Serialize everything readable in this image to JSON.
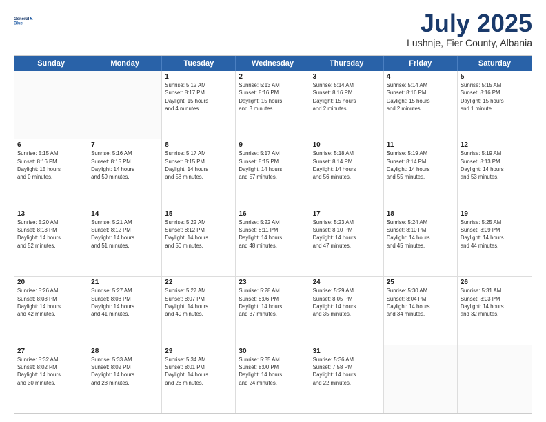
{
  "logo": {
    "line1": "General",
    "line2": "Blue"
  },
  "title": "July 2025",
  "subtitle": "Lushnje, Fier County, Albania",
  "header_days": [
    "Sunday",
    "Monday",
    "Tuesday",
    "Wednesday",
    "Thursday",
    "Friday",
    "Saturday"
  ],
  "weeks": [
    [
      {
        "day": "",
        "info": ""
      },
      {
        "day": "",
        "info": ""
      },
      {
        "day": "1",
        "info": "Sunrise: 5:12 AM\nSunset: 8:17 PM\nDaylight: 15 hours\nand 4 minutes."
      },
      {
        "day": "2",
        "info": "Sunrise: 5:13 AM\nSunset: 8:16 PM\nDaylight: 15 hours\nand 3 minutes."
      },
      {
        "day": "3",
        "info": "Sunrise: 5:14 AM\nSunset: 8:16 PM\nDaylight: 15 hours\nand 2 minutes."
      },
      {
        "day": "4",
        "info": "Sunrise: 5:14 AM\nSunset: 8:16 PM\nDaylight: 15 hours\nand 2 minutes."
      },
      {
        "day": "5",
        "info": "Sunrise: 5:15 AM\nSunset: 8:16 PM\nDaylight: 15 hours\nand 1 minute."
      }
    ],
    [
      {
        "day": "6",
        "info": "Sunrise: 5:15 AM\nSunset: 8:16 PM\nDaylight: 15 hours\nand 0 minutes."
      },
      {
        "day": "7",
        "info": "Sunrise: 5:16 AM\nSunset: 8:15 PM\nDaylight: 14 hours\nand 59 minutes."
      },
      {
        "day": "8",
        "info": "Sunrise: 5:17 AM\nSunset: 8:15 PM\nDaylight: 14 hours\nand 58 minutes."
      },
      {
        "day": "9",
        "info": "Sunrise: 5:17 AM\nSunset: 8:15 PM\nDaylight: 14 hours\nand 57 minutes."
      },
      {
        "day": "10",
        "info": "Sunrise: 5:18 AM\nSunset: 8:14 PM\nDaylight: 14 hours\nand 56 minutes."
      },
      {
        "day": "11",
        "info": "Sunrise: 5:19 AM\nSunset: 8:14 PM\nDaylight: 14 hours\nand 55 minutes."
      },
      {
        "day": "12",
        "info": "Sunrise: 5:19 AM\nSunset: 8:13 PM\nDaylight: 14 hours\nand 53 minutes."
      }
    ],
    [
      {
        "day": "13",
        "info": "Sunrise: 5:20 AM\nSunset: 8:13 PM\nDaylight: 14 hours\nand 52 minutes."
      },
      {
        "day": "14",
        "info": "Sunrise: 5:21 AM\nSunset: 8:12 PM\nDaylight: 14 hours\nand 51 minutes."
      },
      {
        "day": "15",
        "info": "Sunrise: 5:22 AM\nSunset: 8:12 PM\nDaylight: 14 hours\nand 50 minutes."
      },
      {
        "day": "16",
        "info": "Sunrise: 5:22 AM\nSunset: 8:11 PM\nDaylight: 14 hours\nand 48 minutes."
      },
      {
        "day": "17",
        "info": "Sunrise: 5:23 AM\nSunset: 8:10 PM\nDaylight: 14 hours\nand 47 minutes."
      },
      {
        "day": "18",
        "info": "Sunrise: 5:24 AM\nSunset: 8:10 PM\nDaylight: 14 hours\nand 45 minutes."
      },
      {
        "day": "19",
        "info": "Sunrise: 5:25 AM\nSunset: 8:09 PM\nDaylight: 14 hours\nand 44 minutes."
      }
    ],
    [
      {
        "day": "20",
        "info": "Sunrise: 5:26 AM\nSunset: 8:08 PM\nDaylight: 14 hours\nand 42 minutes."
      },
      {
        "day": "21",
        "info": "Sunrise: 5:27 AM\nSunset: 8:08 PM\nDaylight: 14 hours\nand 41 minutes."
      },
      {
        "day": "22",
        "info": "Sunrise: 5:27 AM\nSunset: 8:07 PM\nDaylight: 14 hours\nand 40 minutes."
      },
      {
        "day": "23",
        "info": "Sunrise: 5:28 AM\nSunset: 8:06 PM\nDaylight: 14 hours\nand 37 minutes."
      },
      {
        "day": "24",
        "info": "Sunrise: 5:29 AM\nSunset: 8:05 PM\nDaylight: 14 hours\nand 35 minutes."
      },
      {
        "day": "25",
        "info": "Sunrise: 5:30 AM\nSunset: 8:04 PM\nDaylight: 14 hours\nand 34 minutes."
      },
      {
        "day": "26",
        "info": "Sunrise: 5:31 AM\nSunset: 8:03 PM\nDaylight: 14 hours\nand 32 minutes."
      }
    ],
    [
      {
        "day": "27",
        "info": "Sunrise: 5:32 AM\nSunset: 8:02 PM\nDaylight: 14 hours\nand 30 minutes."
      },
      {
        "day": "28",
        "info": "Sunrise: 5:33 AM\nSunset: 8:02 PM\nDaylight: 14 hours\nand 28 minutes."
      },
      {
        "day": "29",
        "info": "Sunrise: 5:34 AM\nSunset: 8:01 PM\nDaylight: 14 hours\nand 26 minutes."
      },
      {
        "day": "30",
        "info": "Sunrise: 5:35 AM\nSunset: 8:00 PM\nDaylight: 14 hours\nand 24 minutes."
      },
      {
        "day": "31",
        "info": "Sunrise: 5:36 AM\nSunset: 7:58 PM\nDaylight: 14 hours\nand 22 minutes."
      },
      {
        "day": "",
        "info": ""
      },
      {
        "day": "",
        "info": ""
      }
    ]
  ]
}
